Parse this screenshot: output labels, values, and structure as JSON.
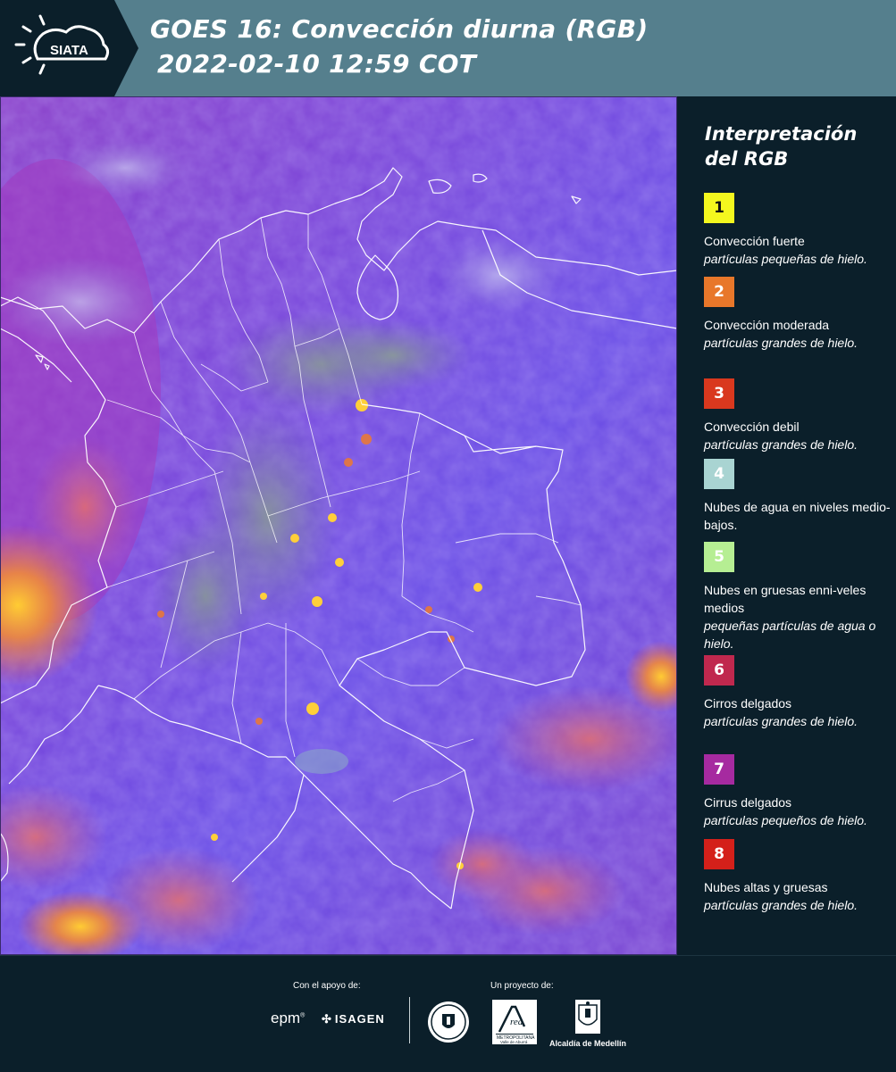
{
  "header": {
    "brand": "SIATA",
    "title_line1": "GOES 16: Convección diurna (RGB)",
    "title_line2": "2022-02-10 12:59 COT"
  },
  "legend": {
    "title_line1": "Interpretación",
    "title_line2": "del RGB",
    "items": [
      {
        "number": "1",
        "color": "#f4f71e",
        "text_color": "#111111",
        "label": "Convección fuerte",
        "sub": "partículas pequeñas de hielo."
      },
      {
        "number": "2",
        "color": "#e8772a",
        "text_color": "#ffffff",
        "label": "Convección moderada",
        "sub": "partículas grandes de hielo."
      },
      {
        "number": "3",
        "color": "#d9381e",
        "text_color": "#ffffff",
        "label": "Convección debil",
        "sub": "partículas grandes de hielo."
      },
      {
        "number": "4",
        "color": "#a9d4d2",
        "text_color": "#ffffff",
        "label": "Nubes de agua en niveles medio-bajos.",
        "sub": ""
      },
      {
        "number": "5",
        "color": "#b6ee93",
        "text_color": "#ffffff",
        "label": "Nubes en gruesas enni-veles medios",
        "sub": "pequeñas partículas de agua o hielo."
      },
      {
        "number": "6",
        "color": "#c0284e",
        "text_color": "#ffffff",
        "label": "Cirros delgados",
        "sub": "partículas grandes de hielo."
      },
      {
        "number": "7",
        "color": "#a62aa0",
        "text_color": "#ffffff",
        "label": "Cirrus delgados",
        "sub": "partículas pequeños de hielo."
      },
      {
        "number": "8",
        "color": "#d4201a",
        "text_color": "#ffffff",
        "label": "Nubes altas y gruesas",
        "sub": "partículas grandes de hielo."
      }
    ]
  },
  "footer": {
    "support_label": "Con el apoyo de:",
    "project_label": "Un proyecto de:",
    "sponsor_1": "epm",
    "sponsor_2": "ISAGEN",
    "partner_1": "Área Metropolitana Valle de Aburrá",
    "partner_2": "Alcaldía de Medellín"
  },
  "colors": {
    "header_bg": "#557f8d",
    "page_bg": "#0b1f2a",
    "map_base": "#7a3fd8"
  }
}
